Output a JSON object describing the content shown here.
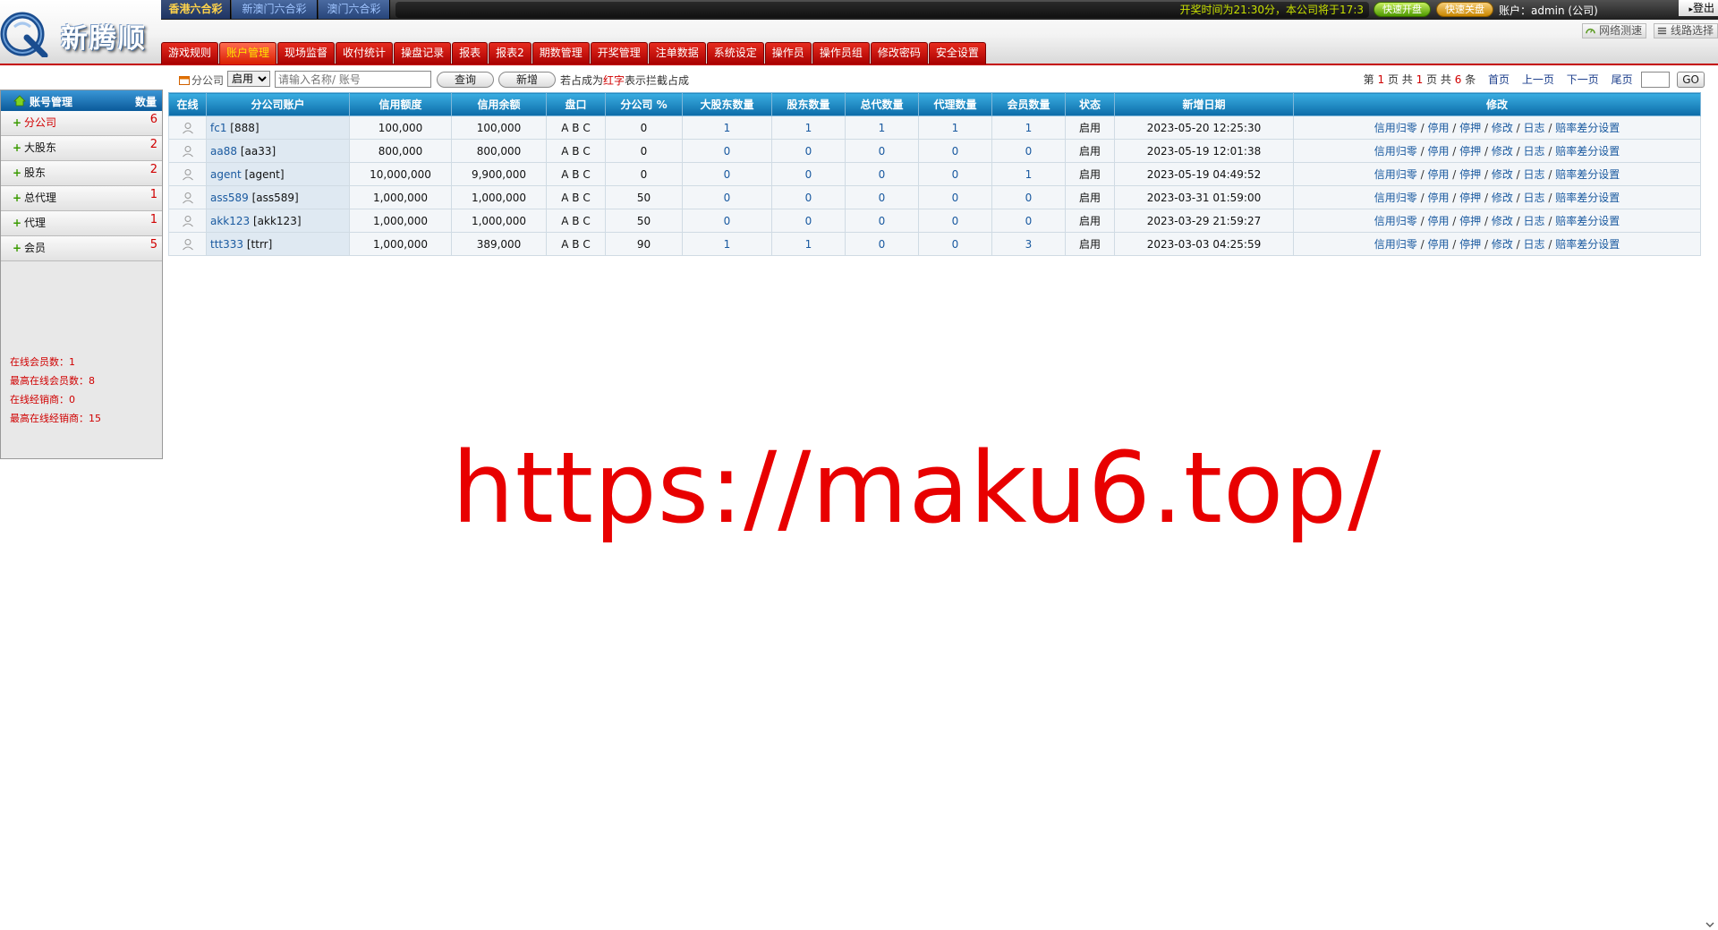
{
  "header": {
    "logo_text": "新腾顺",
    "lottery_tabs": [
      "香港六合彩",
      "新澳门六合彩",
      "澳门六合彩"
    ],
    "marquee": "开奖时间为21:30分，本公司将于17:3",
    "fast_open": "快速开盘",
    "fast_stop": "快速关盘",
    "account": "账户：admin (公司)",
    "logout": "登出",
    "tools": [
      "网络测速",
      "线路选择"
    ],
    "nav": [
      "游戏规则",
      "账户管理",
      "现场监督",
      "收付统计",
      "操盘记录",
      "报表",
      "报表2",
      "期数管理",
      "开奖管理",
      "注单数据",
      "系统设定",
      "操作员",
      "操作员组",
      "修改密码",
      "安全设置"
    ],
    "nav_active": "账户管理"
  },
  "sidebar": {
    "title": "账号管理",
    "count_label": "数量",
    "items": [
      {
        "label": "分公司",
        "count": "6"
      },
      {
        "label": "大股东",
        "count": "2"
      },
      {
        "label": "股东",
        "count": "2"
      },
      {
        "label": "总代理",
        "count": "1"
      },
      {
        "label": "代理",
        "count": "1"
      },
      {
        "label": "会员",
        "count": "5"
      }
    ],
    "stats": [
      "在线会员数：1",
      "最高在线会员数：8",
      "在线经销商：0",
      "最高在线经销商：15"
    ]
  },
  "filter": {
    "label": "分公司",
    "status_selected": "启用",
    "search_placeholder": "请输入名称/ 账号",
    "query_button": "查询",
    "add_button": "新增",
    "hint_prefix": "若占成为",
    "hint_red": "红字",
    "hint_suffix": "表示拦截占成"
  },
  "pager": {
    "p1": "第",
    "page": "1",
    "p2": "页 共",
    "total_pages": "1",
    "p3": "页 共",
    "total_records": "6",
    "p4": "条",
    "first": "首页",
    "prev": "上一页",
    "next": "下一页",
    "last": "尾页",
    "go": "GO"
  },
  "table": {
    "headers": [
      "在线",
      "分公司账户",
      "信用额度",
      "信用余额",
      "盘口",
      "分公司 %",
      "大股东数量",
      "股东数量",
      "总代数量",
      "代理数量",
      "会员数量",
      "状态",
      "新增日期",
      "修改"
    ],
    "rows": [
      {
        "account": "fc1",
        "name": "[888]",
        "credit": "100,000",
        "balance": "100,000",
        "pan": "A B C",
        "pct": "0",
        "big": "1",
        "share": "1",
        "general": "1",
        "agent": "1",
        "member": "1",
        "status": "启用",
        "date": "2023-05-20 12:25:30"
      },
      {
        "account": "aa88",
        "name": "[aa33]",
        "credit": "800,000",
        "balance": "800,000",
        "pan": "A B C",
        "pct": "0",
        "big": "0",
        "share": "0",
        "general": "0",
        "agent": "0",
        "member": "0",
        "status": "启用",
        "date": "2023-05-19 12:01:38"
      },
      {
        "account": "agent",
        "name": "[agent]",
        "credit": "10,000,000",
        "balance": "9,900,000",
        "pan": "A B C",
        "pct": "0",
        "big": "0",
        "share": "0",
        "general": "0",
        "agent": "0",
        "member": "1",
        "status": "启用",
        "date": "2023-05-19 04:49:52"
      },
      {
        "account": "ass589",
        "name": "[ass589]",
        "credit": "1,000,000",
        "balance": "1,000,000",
        "pan": "A B C",
        "pct": "50",
        "big": "0",
        "share": "0",
        "general": "0",
        "agent": "0",
        "member": "0",
        "status": "启用",
        "date": "2023-03-31 01:59:00"
      },
      {
        "account": "akk123",
        "name": "[akk123]",
        "credit": "1,000,000",
        "balance": "1,000,000",
        "pan": "A B C",
        "pct": "50",
        "big": "0",
        "share": "0",
        "general": "0",
        "agent": "0",
        "member": "0",
        "status": "启用",
        "date": "2023-03-29 21:59:27"
      },
      {
        "account": "ttt333",
        "name": "[ttrr]",
        "credit": "1,000,000",
        "balance": "389,000",
        "pan": "A B C",
        "pct": "90",
        "big": "1",
        "share": "1",
        "general": "0",
        "agent": "0",
        "member": "3",
        "status": "启用",
        "date": "2023-03-03 04:25:59"
      }
    ],
    "actions": [
      "信用归零",
      "停用",
      "停押",
      "修改",
      "日志",
      "赔率差分设置"
    ],
    "action_sep": " / "
  },
  "watermark": "https://maku6.top/",
  "colors": {
    "brand_red": "#c40000",
    "header_blue": "#0c6ca8",
    "link_blue": "#1a5aa0",
    "accent_yellow": "#ffe400"
  }
}
